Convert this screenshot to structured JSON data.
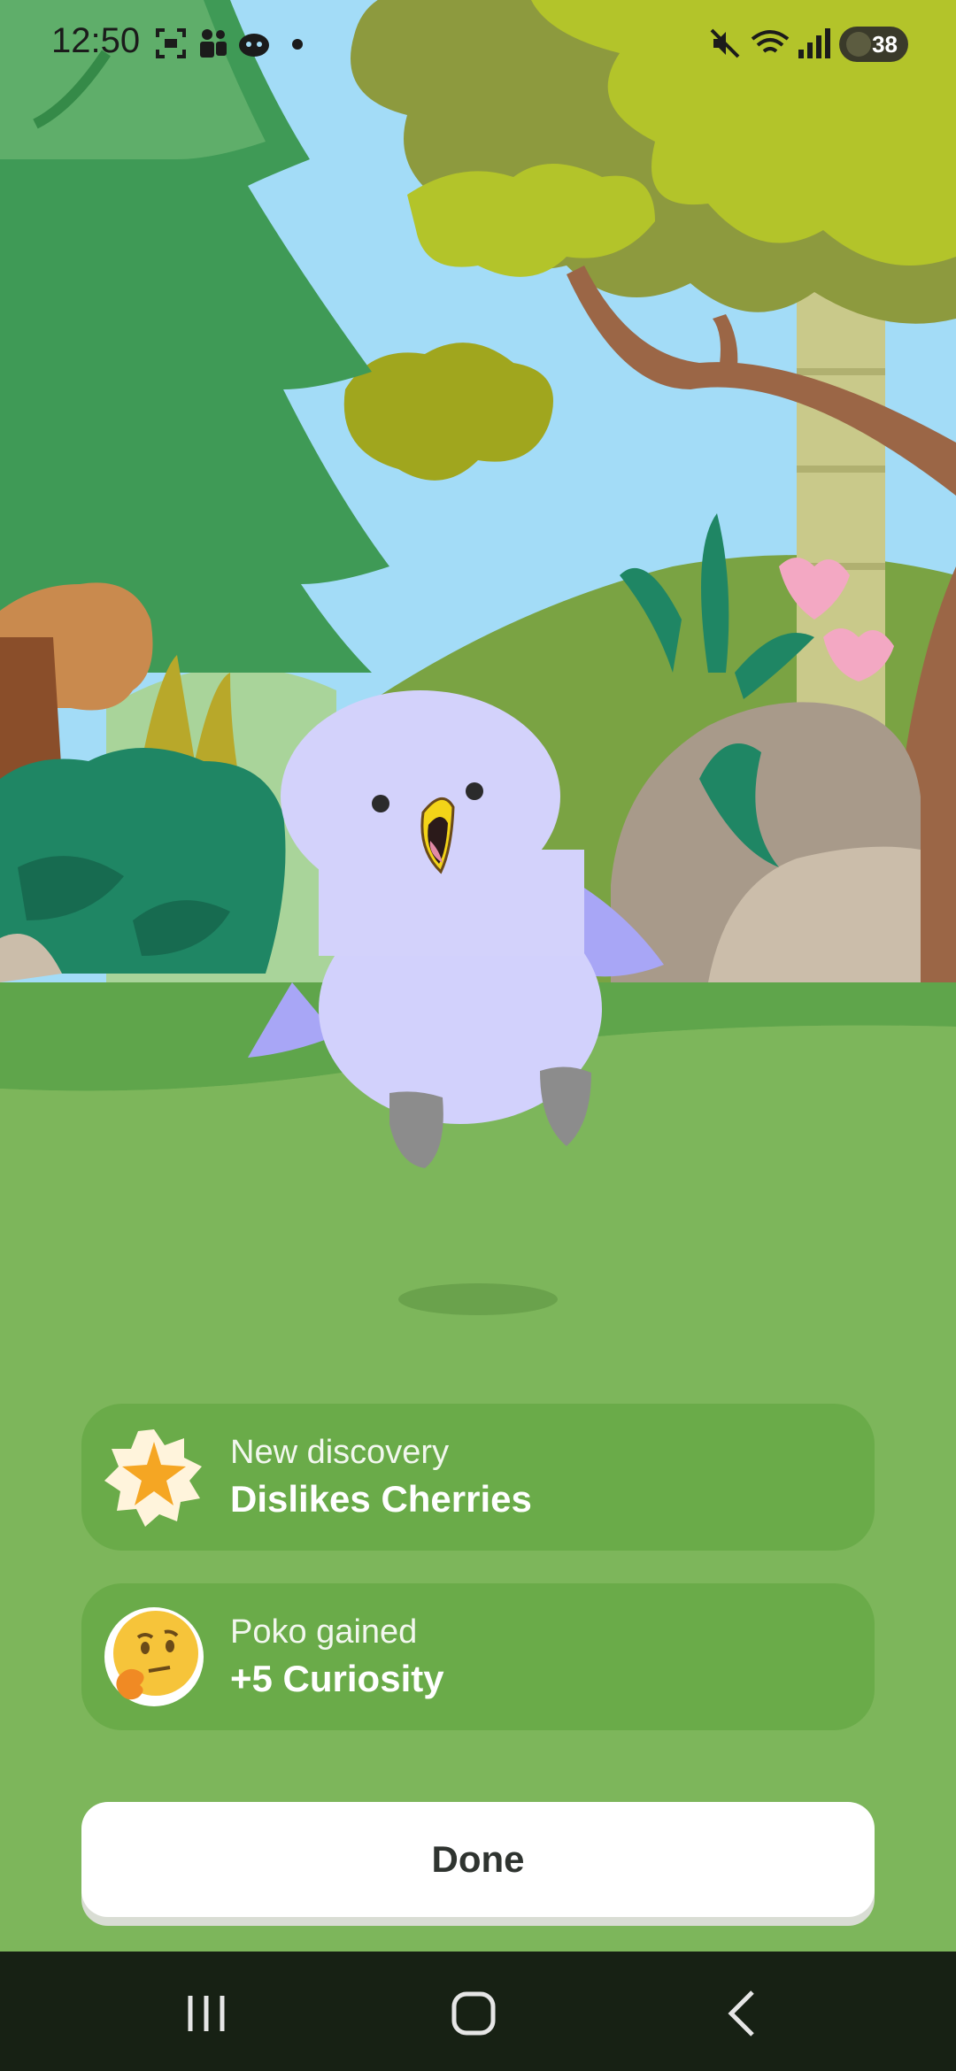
{
  "status_bar": {
    "time": "12:50",
    "battery": "38",
    "icons": [
      "screenshot-icon",
      "teams-icon",
      "game-icon",
      "dot-icon",
      "mute-icon",
      "wifi-icon",
      "signal-icon",
      "battery-icon"
    ]
  },
  "discovery_card": {
    "label": "New discovery",
    "value": "Dislikes Cherries",
    "icon": "star-badge-icon"
  },
  "gain_card": {
    "label": "Poko gained",
    "value": "+5 Curiosity",
    "icon": "thinking-face-icon"
  },
  "done_button": {
    "label": "Done"
  },
  "navigation": {
    "buttons": [
      "recents-icon",
      "home-icon",
      "back-icon"
    ]
  },
  "colors": {
    "background_green": "#7db65b",
    "card_green": "#6aab49",
    "button_white": "#ffffff",
    "nav_dark": "#172114"
  }
}
